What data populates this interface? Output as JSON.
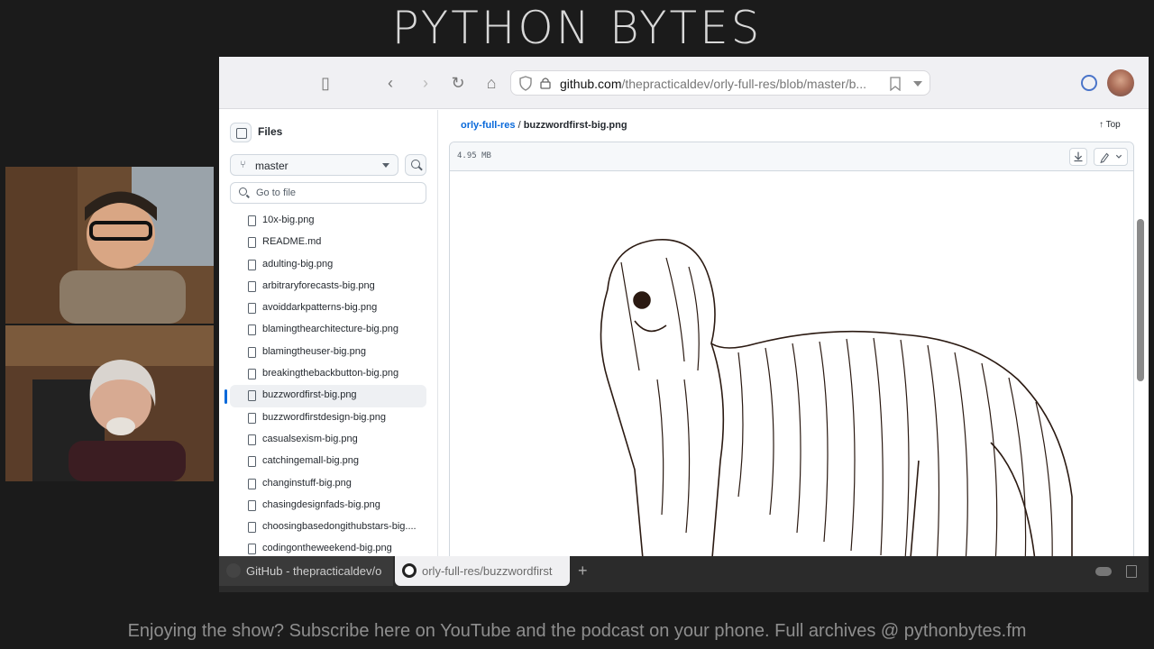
{
  "brand": "PYTHON BYTES",
  "browser": {
    "url_host": "github.com",
    "url_path": "/thepracticaldev/orly-full-res/blob/master/b...",
    "tabs": [
      {
        "label": "GitHub - thepracticaldev/o"
      },
      {
        "label": "orly-full-res/buzzwordfirst"
      }
    ]
  },
  "sidebar": {
    "title": "Files",
    "branch": "master",
    "goto_placeholder": "Go to file",
    "files": [
      {
        "name": "10x-big.png"
      },
      {
        "name": "README.md"
      },
      {
        "name": "adulting-big.png"
      },
      {
        "name": "arbitraryforecasts-big.png"
      },
      {
        "name": "avoiddarkpatterns-big.png"
      },
      {
        "name": "blamingthearchitecture-big.png"
      },
      {
        "name": "blamingtheuser-big.png"
      },
      {
        "name": "breakingthebackbutton-big.png"
      },
      {
        "name": "buzzwordfirst-big.png",
        "active": true
      },
      {
        "name": "buzzwordfirstdesign-big.png"
      },
      {
        "name": "casualsexism-big.png"
      },
      {
        "name": "catchingemall-big.png"
      },
      {
        "name": "changinstuff-big.png"
      },
      {
        "name": "chasingdesignfads-big.png"
      },
      {
        "name": "choosingbasedongithubstars-big...."
      },
      {
        "name": "codingontheweekend-big.png"
      }
    ]
  },
  "main": {
    "crumb_repo": "orly-full-res",
    "crumb_sep": " / ",
    "crumb_file": "buzzwordfirst-big.png",
    "top_link": "Top",
    "file_size": "4.95 MB"
  },
  "footer": "Enjoying the show? Subscribe here on YouTube and the podcast on your phone. Full archives @ pythonbytes.fm",
  "colors": {
    "link": "#0969da",
    "bg": "#1b1b1b"
  }
}
